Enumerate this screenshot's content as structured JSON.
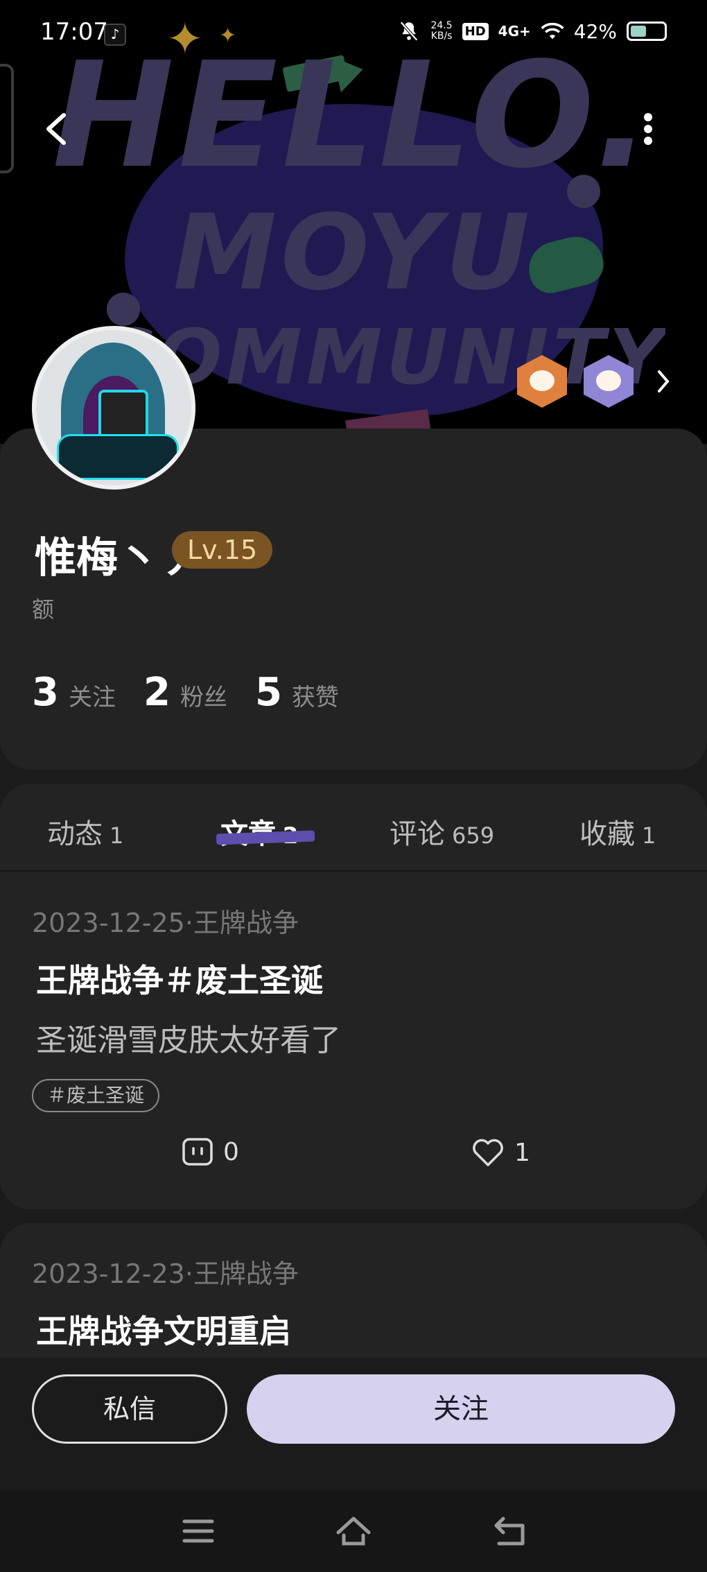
{
  "status_bar": {
    "time": "17:07",
    "net_speed_value": "24.5",
    "net_speed_unit": "KB/s",
    "hd": "HD",
    "network": "4G+",
    "battery": "42%"
  },
  "banner": {
    "line1": "HELLO.",
    "line2": "MOYU",
    "line3": "COMMUNITY"
  },
  "profile": {
    "username": "惟梅丶丿",
    "level": "Lv.15",
    "signature": "额",
    "stats": [
      {
        "value": "3",
        "label": "关注"
      },
      {
        "value": "2",
        "label": "粉丝"
      },
      {
        "value": "5",
        "label": "获赞"
      }
    ],
    "medals": [
      "orange-fish-medal",
      "purple-fish-medal"
    ]
  },
  "tabs": [
    {
      "label": "动态",
      "count": "1"
    },
    {
      "label": "文章",
      "count": "2"
    },
    {
      "label": "评论",
      "count": "659"
    },
    {
      "label": "收藏",
      "count": "1"
    }
  ],
  "active_tab": "文章",
  "articles": [
    {
      "date": "2023-12-25",
      "game": "王牌战争",
      "meta": "2023-12-25·王牌战争",
      "title": "王牌战争＃废土圣诞",
      "excerpt": "圣诞滑雪皮肤太好看了",
      "tag": "＃废土圣诞",
      "comments": "0",
      "likes": "1"
    },
    {
      "date": "2023-12-23",
      "game": "王牌战争",
      "meta": "2023-12-23·王牌战争",
      "title": "王牌战争文明重启"
    }
  ],
  "actions": {
    "message": "私信",
    "follow": "关注"
  },
  "colors": {
    "background": "#1b1b1c",
    "card": "#232324",
    "accent": "#5c4fae",
    "follow_button": "#d7d1f0",
    "level_badge": "#7a5423"
  }
}
